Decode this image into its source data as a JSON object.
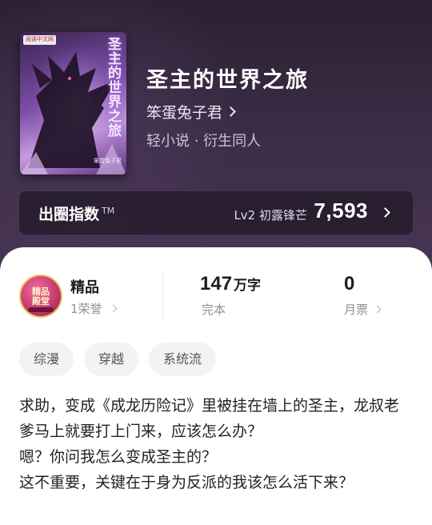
{
  "book": {
    "cover": {
      "badge": "阅读中文网",
      "title": "圣主的世界之旅",
      "author": "笨蛋兔子君"
    },
    "title": "圣主的世界之旅",
    "author": "笨蛋兔子君",
    "genre": "轻小说 · 衍生同人"
  },
  "index": {
    "label": "出圈指数",
    "tm": "TM",
    "level": "Lv2 初露锋芒",
    "value": "7,593"
  },
  "stats": {
    "badge_text": "精品\n殿堂",
    "quality_title": "精品",
    "quality_honor": "1荣誉",
    "word_count_value": "147",
    "word_count_unit": "万字",
    "word_count_status": "完本",
    "monthly_votes_value": "0",
    "monthly_votes_label": "月票"
  },
  "tags": [
    "综漫",
    "穿越",
    "系统流"
  ],
  "synopsis": [
    "求助，变成《成龙历险记》里被挂在墙上的圣主，龙叔老爹马上就要打上门来，应该怎么办？",
    "嗯？你问我怎么变成圣主的？",
    "这不重要，关键在于身为反派的我该怎么活下来？"
  ],
  "colors": {
    "hero_bg": "#3a2c44",
    "text_primary": "#1c1c1c",
    "text_secondary": "#8f8f8f",
    "tag_bg": "#f3f3f3"
  }
}
